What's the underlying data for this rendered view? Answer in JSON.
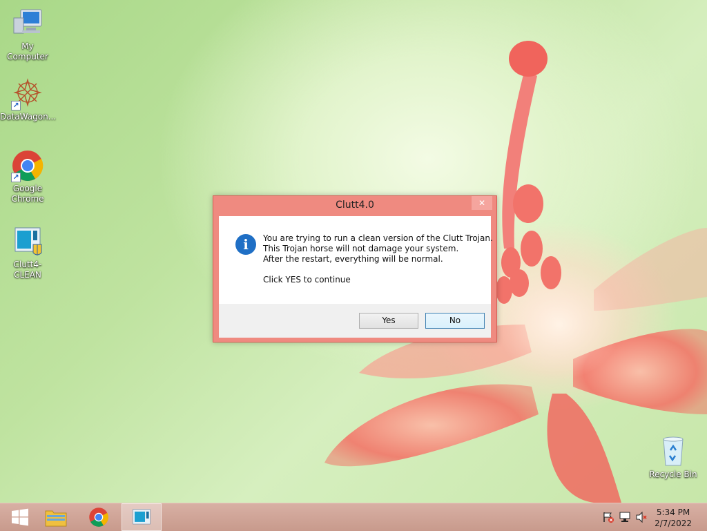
{
  "desktop": {
    "icons": [
      {
        "label": "My Computer",
        "icon": "computer-icon"
      },
      {
        "label": "DataWagon...",
        "icon": "datawagon-icon"
      },
      {
        "label": "Google Chrome",
        "icon": "chrome-icon"
      },
      {
        "label": "Clutt4-CLEAN",
        "icon": "clutt-app-icon"
      },
      {
        "label": "Recycle Bin",
        "icon": "recycle-bin-icon"
      }
    ]
  },
  "dialog": {
    "title": "Clutt4.0",
    "close_glyph": "✕",
    "icon": "info-icon",
    "info_glyph": "i",
    "lines": [
      "You are trying to run a clean version of the Clutt Trojan.",
      "This Trojan horse will not damage your system.",
      "After the restart, everything will be normal.",
      "Click YES to continue"
    ],
    "buttons": {
      "yes": "Yes",
      "no": "No"
    }
  },
  "taskbar": {
    "pinned": [
      {
        "name": "start-button",
        "icon": "windows-logo-icon"
      },
      {
        "name": "file-explorer",
        "icon": "folder-icon"
      },
      {
        "name": "chrome",
        "icon": "chrome-icon"
      },
      {
        "name": "clutt-window",
        "icon": "clutt-app-icon",
        "active": true
      }
    ],
    "tray_icons": [
      "action-center-flag-icon",
      "network-icon",
      "volume-muted-icon"
    ],
    "time": "5:34 PM",
    "date": "2/7/2022"
  },
  "colors": {
    "dialog_frame": "#ef8a80",
    "taskbar": "#c89a8c",
    "info_blue": "#1f6fc5"
  }
}
